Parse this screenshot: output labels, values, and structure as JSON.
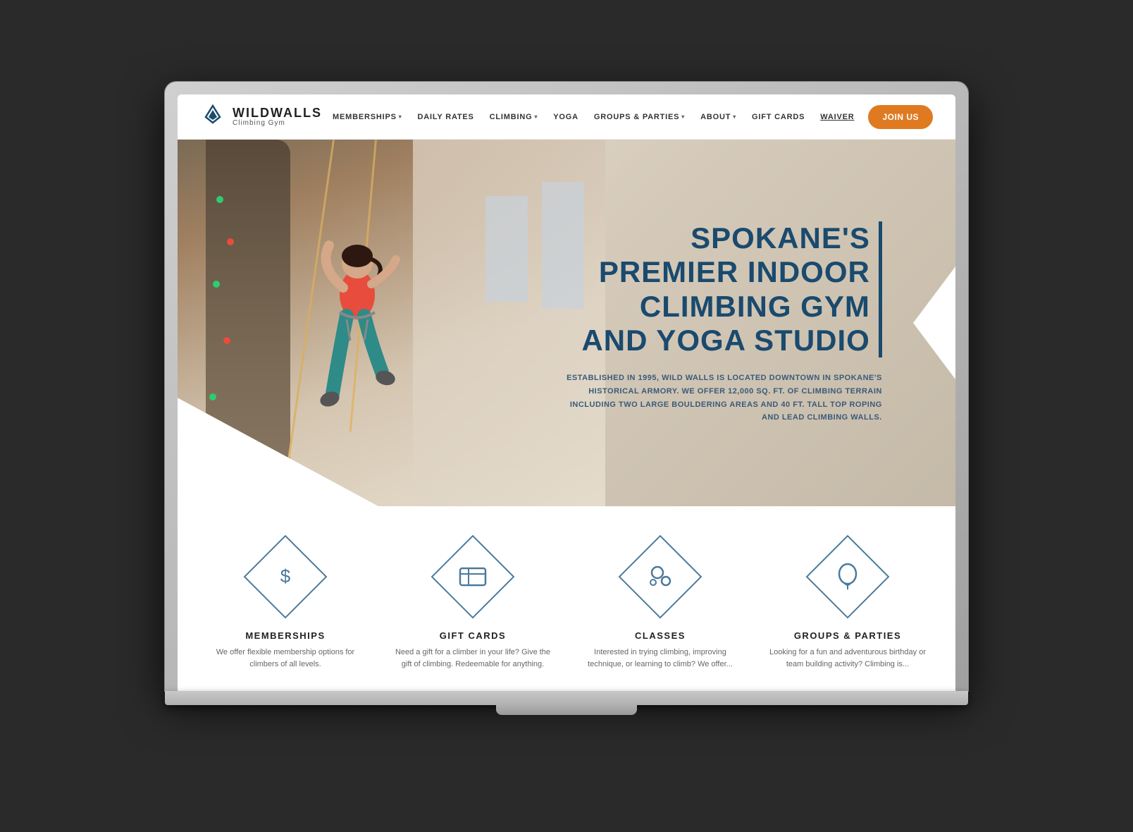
{
  "logo": {
    "name": "WILD",
    "name2": "WALLS",
    "subtitle": "Climbing Gym"
  },
  "nav": {
    "items": [
      {
        "label": "MEMBERSHIPS",
        "hasDropdown": true
      },
      {
        "label": "DAILY RATES",
        "hasDropdown": false
      },
      {
        "label": "CLIMBING",
        "hasDropdown": true
      },
      {
        "label": "YOGA",
        "hasDropdown": false
      },
      {
        "label": "GROUPS & PARTIES",
        "hasDropdown": true
      },
      {
        "label": "ABOUT",
        "hasDropdown": true
      },
      {
        "label": "GIFT CARDS",
        "hasDropdown": false
      },
      {
        "label": "WAIVER",
        "hasDropdown": false,
        "underline": true
      }
    ],
    "join_label": "JOIN US"
  },
  "hero": {
    "title_line1": "SPOKANE'S",
    "title_line2": "PREMIER INDOOR",
    "title_line3": "CLIMBING GYM",
    "title_line4": "AND YOGA STUDIO",
    "description": "ESTABLISHED IN 1995, WILD WALLS IS LOCATED DOWNTOWN IN SPOKANE'S HISTORICAL ARMORY. WE OFFER 12,000 SQ. FT. OF CLIMBING TERRAIN INCLUDING TWO LARGE BOULDERING AREAS AND 40 FT. TALL TOP ROPING AND LEAD CLIMBING WALLS."
  },
  "cards": [
    {
      "icon": "$",
      "title": "MEMBERSHIPS",
      "description": "We offer flexible membership options for climbers of all levels."
    },
    {
      "icon": "▦",
      "title": "GIFT CARDS",
      "description": "Need a gift for a climber in your life? Give the gift of climbing. Redeemable for anything."
    },
    {
      "icon": "⊛",
      "title": "CLASSES",
      "description": "Interested in trying climbing, improving technique, or learning to climb? We offer..."
    },
    {
      "icon": "◯",
      "title": "GROUPS & PARTIES",
      "description": "Looking for a fun and adventurous birthday or team building activity? Climbing is..."
    }
  ]
}
